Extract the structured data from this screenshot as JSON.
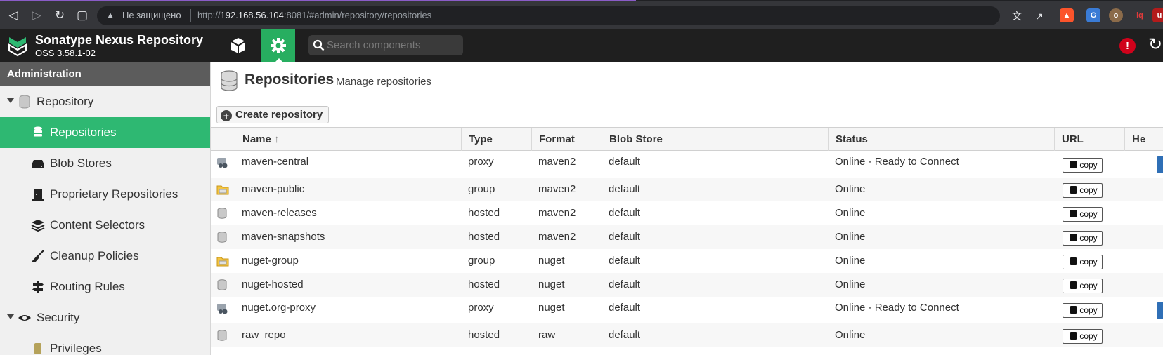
{
  "browser": {
    "insecure_label": "Не защищено",
    "url_prefix": "http://",
    "url_host": "192.168.56.104",
    "url_rest": ":8081/#admin/repository/repositories"
  },
  "header": {
    "title": "Sonatype Nexus Repository",
    "version": "OSS 3.58.1-02",
    "search_placeholder": "Search components"
  },
  "sidebar": {
    "title": "Administration",
    "items": [
      {
        "label": "Repository"
      },
      {
        "label": "Repositories"
      },
      {
        "label": "Blob Stores"
      },
      {
        "label": "Proprietary Repositories"
      },
      {
        "label": "Content Selectors"
      },
      {
        "label": "Cleanup Policies"
      },
      {
        "label": "Routing Rules"
      },
      {
        "label": "Security"
      },
      {
        "label": "Privileges"
      }
    ]
  },
  "page": {
    "title": "Repositories",
    "subtitle": "Manage repositories",
    "create_label": "Create repository"
  },
  "table": {
    "headers": {
      "name": "Name",
      "type": "Type",
      "format": "Format",
      "blob": "Blob Store",
      "status": "Status",
      "url": "URL",
      "health": "He"
    },
    "copy_label": "copy",
    "rows": [
      {
        "icon": "proxy-repo-icon",
        "name": "maven-central",
        "type": "proxy",
        "format": "maven2",
        "blob": "default",
        "status": "Online - Ready to Connect"
      },
      {
        "icon": "group-repo-icon",
        "name": "maven-public",
        "type": "group",
        "format": "maven2",
        "blob": "default",
        "status": "Online"
      },
      {
        "icon": "hosted-repo-icon",
        "name": "maven-releases",
        "type": "hosted",
        "format": "maven2",
        "blob": "default",
        "status": "Online"
      },
      {
        "icon": "hosted-repo-icon",
        "name": "maven-snapshots",
        "type": "hosted",
        "format": "maven2",
        "blob": "default",
        "status": "Online"
      },
      {
        "icon": "group-repo-icon",
        "name": "nuget-group",
        "type": "group",
        "format": "nuget",
        "blob": "default",
        "status": "Online"
      },
      {
        "icon": "hosted-repo-icon",
        "name": "nuget-hosted",
        "type": "hosted",
        "format": "nuget",
        "blob": "default",
        "status": "Online"
      },
      {
        "icon": "proxy-repo-icon",
        "name": "nuget.org-proxy",
        "type": "proxy",
        "format": "nuget",
        "blob": "default",
        "status": "Online - Ready to Connect"
      },
      {
        "icon": "hosted-repo-icon",
        "name": "raw_repo",
        "type": "hosted",
        "format": "raw",
        "blob": "default",
        "status": "Online"
      }
    ]
  },
  "colors": {
    "accent": "#27ae60",
    "selected": "#2eb872",
    "header_bg": "#1f1f1f",
    "alert": "#d0021b"
  }
}
